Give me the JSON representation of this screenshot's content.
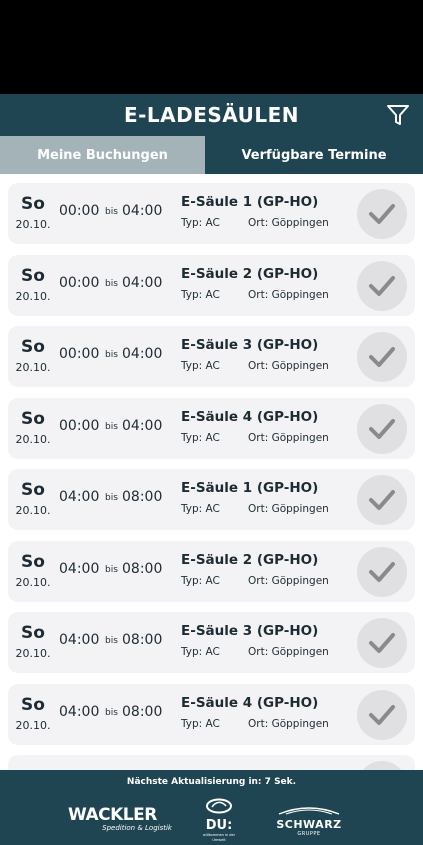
{
  "header": {
    "title": "E-LADESÄULEN",
    "filter_icon": "filter-icon"
  },
  "tabs": [
    {
      "label": "Meine Buchungen",
      "active": false
    },
    {
      "label": "Verfügbare Termine",
      "active": true
    }
  ],
  "bookings": [
    {
      "day": "So",
      "date": "20.10.",
      "from": "00:00",
      "bis": "bis",
      "to": "04:00",
      "name": "E-Säule 1 (GP-HO)",
      "type": "Typ: AC",
      "place": "Ort: Göppingen"
    },
    {
      "day": "So",
      "date": "20.10.",
      "from": "00:00",
      "bis": "bis",
      "to": "04:00",
      "name": "E-Säule 2 (GP-HO)",
      "type": "Typ: AC",
      "place": "Ort: Göppingen"
    },
    {
      "day": "So",
      "date": "20.10.",
      "from": "00:00",
      "bis": "bis",
      "to": "04:00",
      "name": "E-Säule 3 (GP-HO)",
      "type": "Typ: AC",
      "place": "Ort: Göppingen"
    },
    {
      "day": "So",
      "date": "20.10.",
      "from": "00:00",
      "bis": "bis",
      "to": "04:00",
      "name": "E-Säule 4 (GP-HO)",
      "type": "Typ: AC",
      "place": "Ort: Göppingen"
    },
    {
      "day": "So",
      "date": "20.10.",
      "from": "04:00",
      "bis": "bis",
      "to": "08:00",
      "name": "E-Säule 1 (GP-HO)",
      "type": "Typ: AC",
      "place": "Ort: Göppingen"
    },
    {
      "day": "So",
      "date": "20.10.",
      "from": "04:00",
      "bis": "bis",
      "to": "08:00",
      "name": "E-Säule 2 (GP-HO)",
      "type": "Typ: AC",
      "place": "Ort: Göppingen"
    },
    {
      "day": "So",
      "date": "20.10.",
      "from": "04:00",
      "bis": "bis",
      "to": "08:00",
      "name": "E-Säule 3 (GP-HO)",
      "type": "Typ: AC",
      "place": "Ort: Göppingen"
    },
    {
      "day": "So",
      "date": "20.10.",
      "from": "04:00",
      "bis": "bis",
      "to": "08:00",
      "name": "E-Säule 4 (GP-HO)",
      "type": "Typ: AC",
      "place": "Ort: Göppingen"
    }
  ],
  "footer": {
    "refresh_text": "Nächste Aktualisierung in: 7 Sek.",
    "logos": {
      "wackler": {
        "name": "WACKLER",
        "tagline": "Spedition & Logistik"
      },
      "du": {
        "name": "DU:",
        "tagline": "willkommen in der Umwelt"
      },
      "schwarz": {
        "name": "SCHWARZ",
        "tagline": "GRUPPE"
      }
    }
  },
  "colors": {
    "primary": "#1f4452",
    "tab_inactive": "#a3b3b8",
    "card_bg": "#f3f3f6",
    "check_bg": "#e0e0e3",
    "check_icon": "#8a8a8e"
  }
}
